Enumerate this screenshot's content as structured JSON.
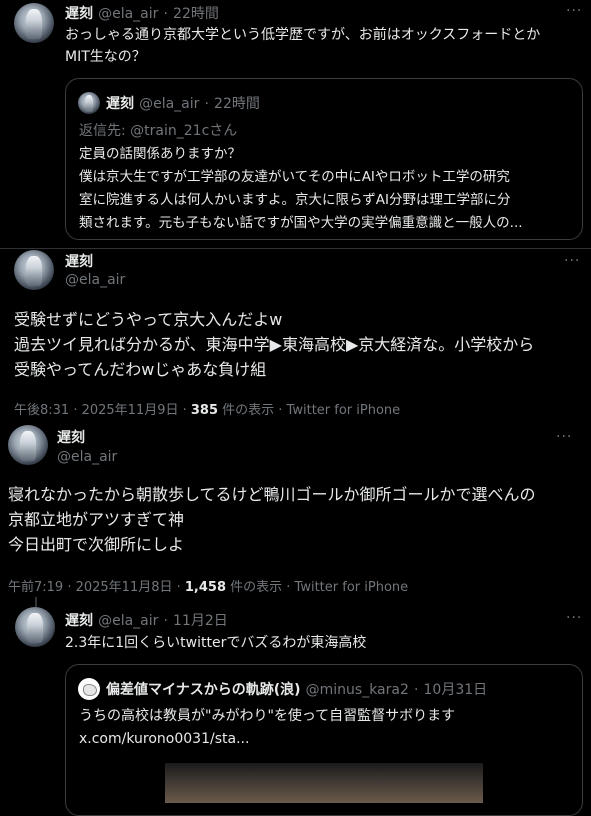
{
  "tweet1": {
    "name": "遅刻",
    "handle": "@ela_air",
    "time": "22時間",
    "more": "···",
    "text_line1": "おっしゃる通り京都大学という低学歴ですが、お前はオックスフォードとか",
    "text_line2": "MIT生なの？",
    "quote": {
      "name": "遅刻",
      "handle": "@ela_air",
      "time": "22時間",
      "reply_to": "返信先: @train_21cさん",
      "line1": "定員の話関係ありますか？",
      "line2": "僕は京大生ですが工学部の友達がいてその中にAIやロボット工学の研究",
      "line3": "室に院進する人は何人かいますよ。京大に限らずAI分野は理工学部に分",
      "line4": "類されます。元も子もない話ですが国や大学の実学偏重意識と一般人の..."
    }
  },
  "tweet2": {
    "name": "遅刻",
    "handle": "@ela_air",
    "more": "···",
    "line1": "受験せずにどうやって京大入んだよw",
    "line2": "過去ツイ見れば分かるが、東海中学▶東海高校▶京大経済な。小学校から",
    "line3": "受験やってんだわwじゃあな負け組",
    "meta_time": "午後8:31 · 2025年11月9日 · ",
    "views": "385",
    "meta_tail": " 件の表示 · Twitter for iPhone"
  },
  "tweet3": {
    "name": "遅刻",
    "handle": "@ela_air",
    "more": "···",
    "line1": "寝れなかったから朝散歩してるけど鴨川ゴールか御所ゴールかで選べんの",
    "line2": "京都立地がアツすぎて神",
    "line3": "今日出町で次御所にしよ",
    "meta_time": "午前7:19 · 2025年11月8日 · ",
    "views": "1,458",
    "meta_tail": " 件の表示 · Twitter for iPhone"
  },
  "tweet4": {
    "name": "遅刻",
    "handle": "@ela_air",
    "time": "11月2日",
    "more": "···",
    "text": "2.3年に1回くらいtwitterでバズるわが東海高校",
    "quote": {
      "name": "偏差値マイナスからの軌跡(浪)",
      "handle": "@minus_kara2",
      "time": "10月31日",
      "line1": "うちの高校は教員が\"みがわり\"を使って自習監督サボります",
      "line2": "x.com/kurono0031/sta..."
    }
  },
  "colors": {
    "background": "#000000",
    "text": "#e7e9ea",
    "secondary": "#71767b",
    "border": "#2f3336"
  }
}
